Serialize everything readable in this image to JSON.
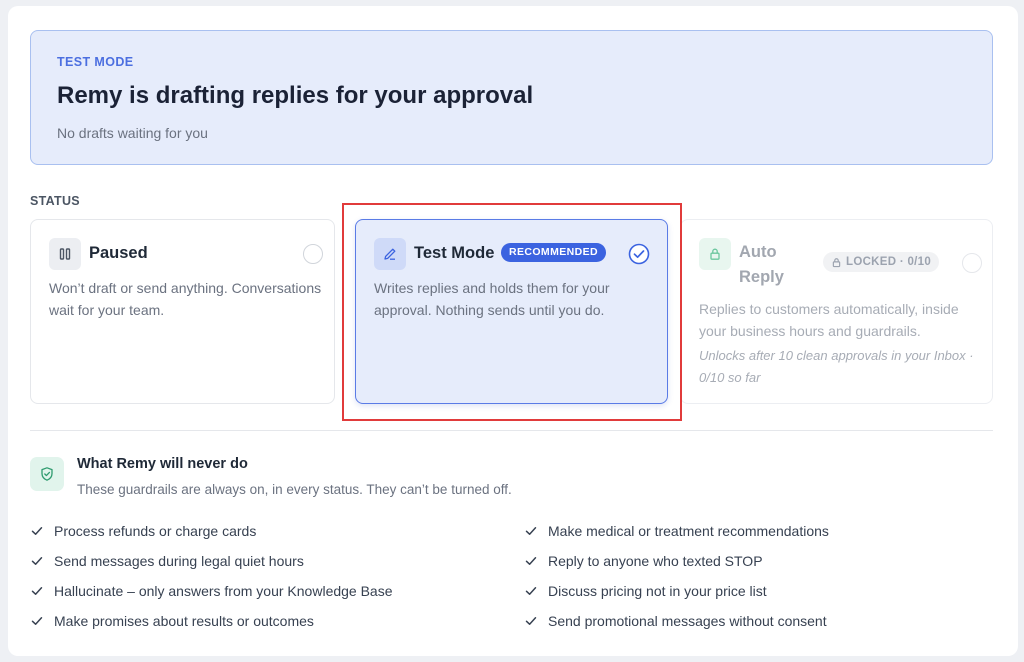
{
  "banner": {
    "eyebrow": "TEST MODE",
    "title": "Remy is drafting replies for your approval",
    "subtitle": "No drafts waiting for you"
  },
  "status": {
    "label": "STATUS",
    "options": [
      {
        "name": "Paused",
        "icon": "pause-icon",
        "description": "Won’t draft or send anything. Conversations wait for your team.",
        "selected": false
      },
      {
        "name": "Test Mode",
        "icon": "pencil-icon",
        "badge": "RECOMMENDED",
        "description": "Writes replies and holds them for your approval. Nothing sends until you do.",
        "selected": true
      },
      {
        "name": "Auto Reply",
        "icon": "lock-icon",
        "badge": "LOCKED · 0/10",
        "description": "Replies to customers automatically, inside your business hours and guardrails.",
        "note": "Unlocks after 10 clean approvals in your Inbox · 0/10 so far",
        "selected": false,
        "locked": true
      }
    ]
  },
  "guardrails": {
    "icon": "shield-check-icon",
    "title": "What Remy will never do",
    "subtitle": "These guardrails are always on, in every status. They can’t be turned off.",
    "left": [
      "Process refunds or charge cards",
      "Send messages during legal quiet hours",
      "Hallucinate – only answers from your Knowledge Base",
      "Make promises about results or outcomes"
    ],
    "right": [
      "Make medical or treatment recommendations",
      "Reply to anyone who texted STOP",
      "Discuss pricing not in your price list",
      "Send promotional messages without consent"
    ]
  },
  "colors": {
    "accent": "#3b63e0",
    "banner_bg": "#e6ecfb",
    "highlight": "#e13b3b",
    "guard_green": "#2f9b6f"
  }
}
